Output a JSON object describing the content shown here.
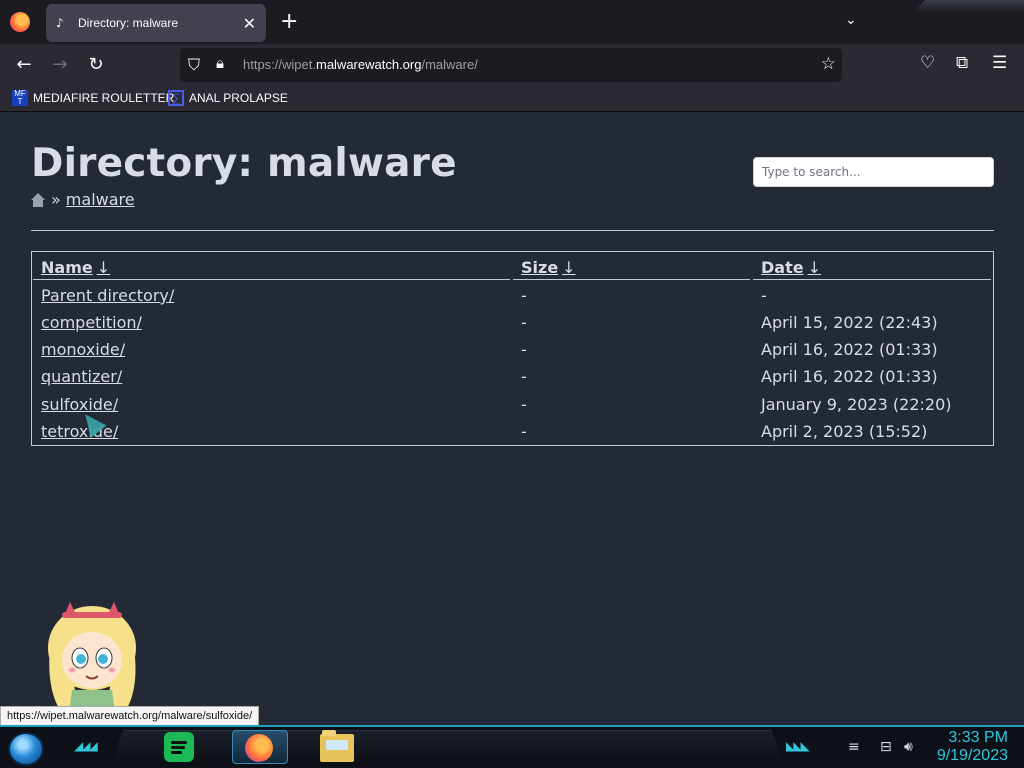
{
  "browser": {
    "tab_title": "Directory: malware",
    "url_prefix": "https://wipet.",
    "url_domain": "malwarewatch.org",
    "url_path": "/malware/",
    "bookmarks": [
      {
        "label": "MEDIAFIRE ROULETTER",
        "icon_text": "MF T"
      },
      {
        "label": "ANAL PROLAPSE",
        "icon_text": "∑"
      }
    ]
  },
  "page": {
    "title": "Directory: malware",
    "search_placeholder": "Type to search...",
    "breadcrumb_separator": "»",
    "breadcrumb_current": "malware",
    "headers": {
      "name": "Name",
      "size": "Size",
      "date": "Date",
      "sort_arrow": "↓"
    },
    "rows": [
      {
        "name": "Parent directory/",
        "size": "-",
        "date": "-"
      },
      {
        "name": "competition/",
        "size": "-",
        "date": "April 15, 2022 (22:43)"
      },
      {
        "name": "monoxide/",
        "size": "-",
        "date": "April 16, 2022 (01:33)"
      },
      {
        "name": "quantizer/",
        "size": "-",
        "date": "April 16, 2022 (01:33)"
      },
      {
        "name": "sulfoxide/",
        "size": "-",
        "date": "January 9, 2023 (22:20)"
      },
      {
        "name": "tetroxide/",
        "size": "-",
        "date": "April 2, 2023 (15:52)"
      }
    ]
  },
  "status_url": "https://wipet.malwarewatch.org/malware/sulfoxide/",
  "taskbar": {
    "time": "3:33 PM",
    "date": "9/19/2023"
  },
  "colors": {
    "page_bg": "#242a35",
    "text": "#d8dce4",
    "accent": "#2ec7dc"
  }
}
